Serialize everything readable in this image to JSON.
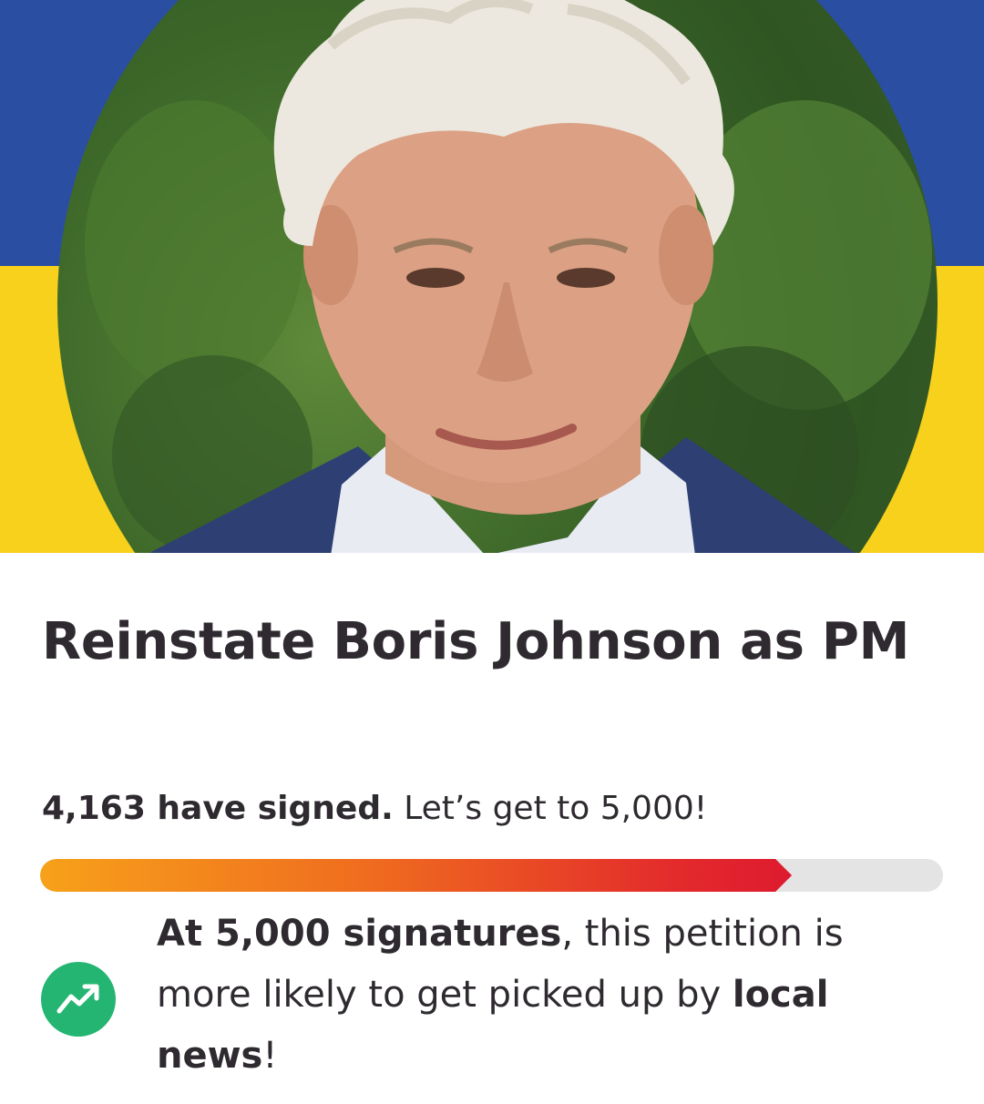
{
  "colors": {
    "flag_blue": "#2a4ea2",
    "flag_yellow": "#f7d11c",
    "progress_track": "#e4e4e4",
    "progress_start": "#f7a11a",
    "progress_end": "#de1a2f",
    "milestone_green": "#25b572"
  },
  "hero": {
    "image": "boris-johnson-portrait",
    "background": "ukraine-flag"
  },
  "petition": {
    "title": "Reinstate Boris Johnson as PM",
    "signed_count": "4,163 have signed.",
    "goal_text": "Let’s get to 5,000!",
    "signatures": 4163,
    "goal": 5000,
    "progress_fraction": 0.8326
  },
  "milestone": {
    "icon": "trending-up-icon",
    "bold_lead": "At 5,000 signatures",
    "middle": ", this petition is more likely to get picked up by ",
    "bold_tail": "local news",
    "end": "!"
  }
}
